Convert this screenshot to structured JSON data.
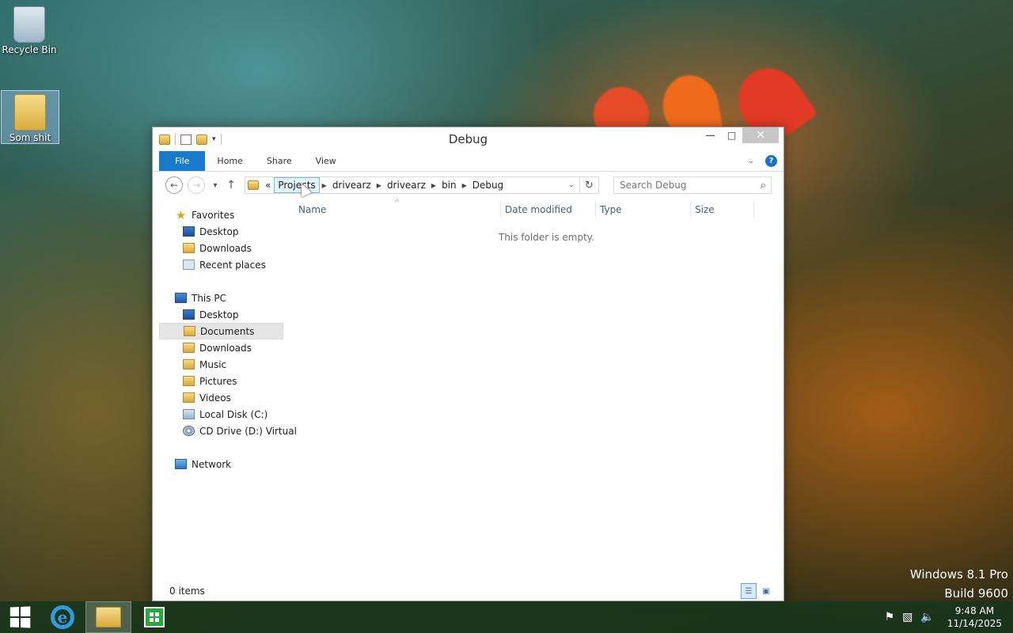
{
  "desktop": {
    "icons": [
      {
        "label": "Recycle Bin",
        "icon": "recycle-bin-icon"
      },
      {
        "label": "Som shit",
        "icon": "folder-icon"
      }
    ],
    "watermark": {
      "line1": "Windows 8.1 Pro",
      "line2": "Build 9600"
    }
  },
  "window": {
    "title": "Debug",
    "ribbon": {
      "tabs": [
        "File",
        "Home",
        "Share",
        "View"
      ],
      "help": "?"
    },
    "nav": {
      "back": "←",
      "forward": "→",
      "recent": "▾",
      "up": "↑",
      "address": {
        "overflow": "«",
        "crumbs": [
          "Projects",
          "drivearz",
          "drivearz",
          "bin",
          "Debug"
        ]
      },
      "refresh": "↻",
      "search_placeholder": "Search Debug",
      "search_icon": "⌕"
    },
    "navpane": {
      "favorites": {
        "label": "Favorites",
        "items": [
          "Desktop",
          "Downloads",
          "Recent places"
        ]
      },
      "this_pc": {
        "label": "This PC",
        "items": [
          "Desktop",
          "Documents",
          "Downloads",
          "Music",
          "Pictures",
          "Videos",
          "Local Disk (C:)",
          "CD Drive (D:) Virtual"
        ]
      },
      "network": {
        "label": "Network"
      },
      "selected": "Documents"
    },
    "columns": [
      "Name",
      "Date modified",
      "Type",
      "Size"
    ],
    "empty_message": "This folder is empty.",
    "status": {
      "items": "0 items"
    }
  },
  "taskbar": {
    "apps": [
      {
        "name": "Internet Explorer",
        "icon": "internet-explorer-icon"
      },
      {
        "name": "File Explorer",
        "icon": "file-explorer-icon",
        "active": true
      },
      {
        "name": "Store",
        "icon": "store-icon"
      }
    ],
    "clock": {
      "time": "9:48 AM",
      "date": "11/14/2025"
    }
  }
}
